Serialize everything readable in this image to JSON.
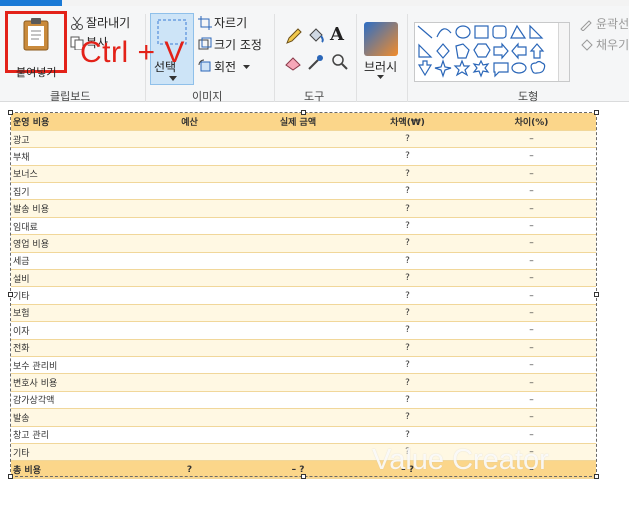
{
  "ribbon": {
    "clipboard": {
      "paste_label": "붙여넣기",
      "cut_label": "잘라내기",
      "copy_label": "복사",
      "group_label": "클립보드"
    },
    "image": {
      "select_label": "선택",
      "crop_label": "자르기",
      "resize_label": "크기 조정",
      "rotate_label": "회전",
      "group_label": "이미지"
    },
    "tools": {
      "group_label": "도구",
      "text_glyph": "A"
    },
    "brushes": {
      "label": "브러시"
    },
    "shapes": {
      "group_label": "도형",
      "outline_label": "윤곽선",
      "fill_label": "채우기"
    }
  },
  "overlay": {
    "shortcut_text": "Ctrl  + V"
  },
  "table": {
    "headers": [
      "운영 비용",
      "예산",
      "실제 금액",
      "차액(₩)",
      "차이(%)"
    ],
    "rows": [
      [
        "광고",
        "",
        "",
        "?",
        "–"
      ],
      [
        "부채",
        "",
        "",
        "?",
        "–"
      ],
      [
        "보너스",
        "",
        "",
        "?",
        "–"
      ],
      [
        "집기",
        "",
        "",
        "?",
        "–"
      ],
      [
        "발송 비용",
        "",
        "",
        "?",
        "–"
      ],
      [
        "임대료",
        "",
        "",
        "?",
        "–"
      ],
      [
        "영업 비용",
        "",
        "",
        "?",
        "–"
      ],
      [
        "세금",
        "",
        "",
        "?",
        "–"
      ],
      [
        "설비",
        "",
        "",
        "?",
        "–"
      ],
      [
        "기타",
        "",
        "",
        "?",
        "–"
      ],
      [
        "보험",
        "",
        "",
        "?",
        "–"
      ],
      [
        "이자",
        "",
        "",
        "?",
        "–"
      ],
      [
        "전화",
        "",
        "",
        "?",
        "–"
      ],
      [
        "보수 관리비",
        "",
        "",
        "?",
        "–"
      ],
      [
        "변호사 비용",
        "",
        "",
        "?",
        "–"
      ],
      [
        "감가상각액",
        "",
        "",
        "?",
        "–"
      ],
      [
        "발송",
        "",
        "",
        "?",
        "–"
      ],
      [
        "창고 관리",
        "",
        "",
        "?",
        "–"
      ],
      [
        "기타",
        "",
        "",
        "?",
        "–"
      ]
    ],
    "total": [
      "총 비용",
      "?",
      "–   ?",
      "–   ?",
      "–"
    ]
  },
  "watermark": {
    "text": "Value Creator"
  },
  "colors": {
    "header_fill": "#fbd68a",
    "band_fill": "#fff8e3",
    "highlight_red": "#e32219",
    "select_blue": "#cde4f7"
  }
}
